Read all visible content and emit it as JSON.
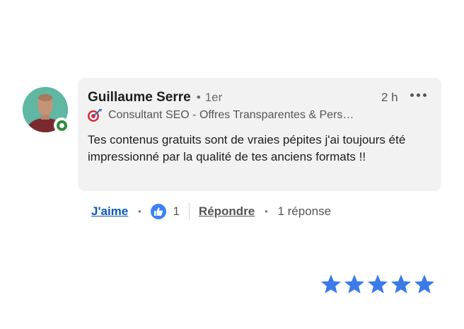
{
  "comment": {
    "author_name": "Guillaume Serre",
    "degree_separator": "•",
    "degree": "1er",
    "time": "2 h",
    "headline_icon": "target-dart-icon",
    "headline": "Consultant SEO - Offres Transparentes & Pers…",
    "text": "Tes contenus gratuits sont de vraies pépites j'ai toujours été impressionné par la qualité de tes anciens formats !!",
    "online_status_color": "#2f8a3a"
  },
  "actions": {
    "like_label": "J'aime",
    "reaction_icon": "thumbs-up-icon",
    "reaction_count": "1",
    "reply_label": "Répondre",
    "reply_count_label": "1 réponse",
    "bullet": "•"
  },
  "rating": {
    "stars": 5,
    "color": "#3b7be8"
  }
}
